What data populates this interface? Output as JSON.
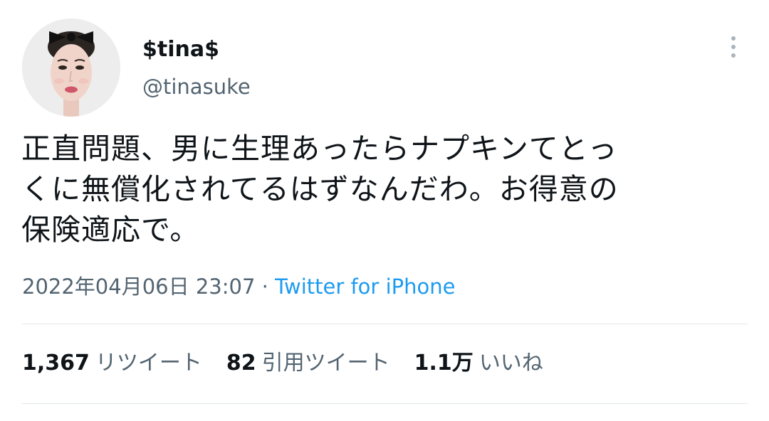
{
  "user": {
    "display_name": "$tina$",
    "handle": "@tinasuke",
    "avatar_icon": "profile-photo"
  },
  "tweet": {
    "lines": [
      "正直問題、男に生理あったらナプキンてとっ",
      "くに無償化されてるはずなんだわ。お得意の",
      "保険適応で。"
    ],
    "timestamp": "2022年04月06日 23:07",
    "separator": " · ",
    "source": "Twitter for iPhone"
  },
  "stats": {
    "retweets": {
      "count": "1,367",
      "label": "リツイート"
    },
    "quotes": {
      "count": "82",
      "label": "引用ツイート"
    },
    "likes": {
      "count": "1.1万",
      "label": "いいね"
    }
  },
  "colors": {
    "text": "#0f1419",
    "secondary": "#536471",
    "link": "#1d9bf0",
    "divider": "#e1e6ea"
  },
  "icons": {
    "more": "more-vertical-icon"
  }
}
